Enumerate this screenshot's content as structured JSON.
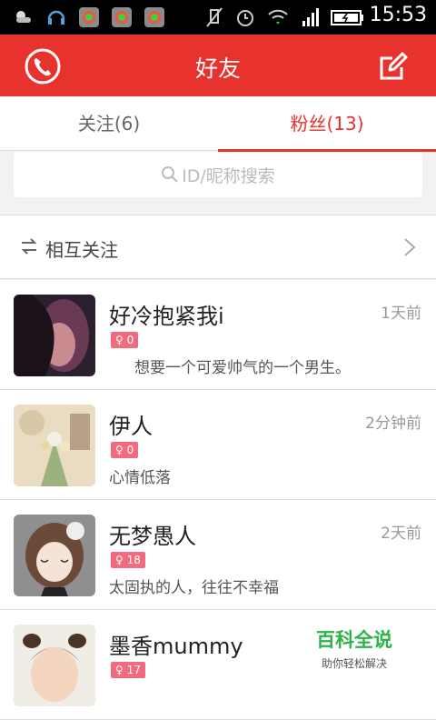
{
  "statusbar": {
    "time": "15:53"
  },
  "appbar": {
    "title": "好友"
  },
  "tabs": [
    {
      "label": "关注(6)"
    },
    {
      "label": "粉丝(13)"
    }
  ],
  "search": {
    "placeholder": "ID/昵称搜索"
  },
  "mutual": {
    "label": "相互关注"
  },
  "friends": [
    {
      "name": "好冷抱紧我i",
      "time": "1天前",
      "badge": "♀ 0",
      "signature": "想要一个可爱帅气的一个男生。"
    },
    {
      "name": "伊人",
      "time": "2分钟前",
      "badge": "♀ 0",
      "signature": "心情低落"
    },
    {
      "name": "无梦愚人",
      "time": "2天前",
      "badge": "♀ 18",
      "signature": "太固执的人，往往不幸福"
    },
    {
      "name": "墨香mummy",
      "time": "",
      "badge": "♀ 17",
      "signature": ""
    }
  ],
  "watermark": {
    "title": "百科全说",
    "subtitle": "助你轻松解决"
  },
  "colors": {
    "accent": "#e8322e",
    "badge": "#f26a7e"
  }
}
